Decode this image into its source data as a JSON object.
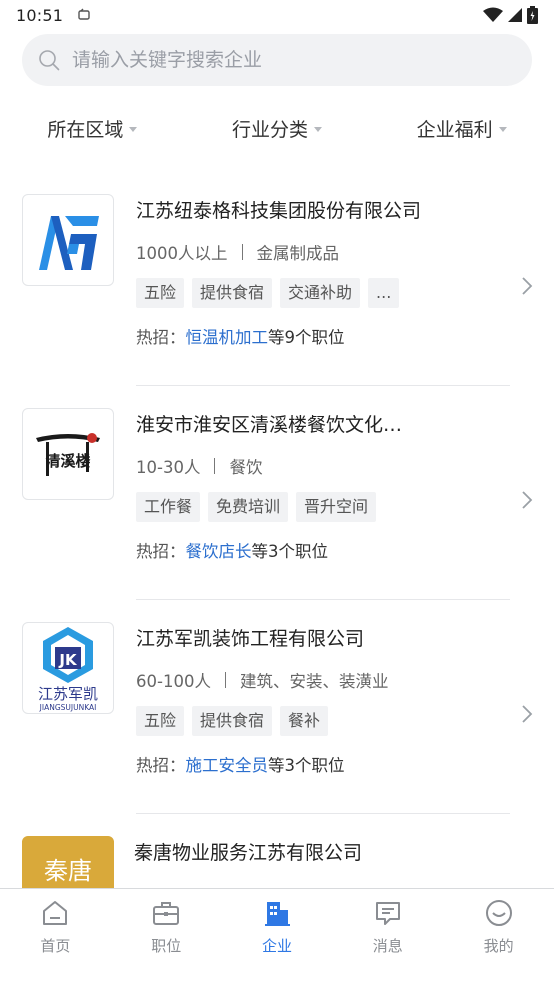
{
  "status_bar": {
    "time": "10:51"
  },
  "search": {
    "placeholder": "请输入关键字搜索企业"
  },
  "filters": [
    {
      "label": "所在区域"
    },
    {
      "label": "行业分类"
    },
    {
      "label": "企业福利"
    }
  ],
  "companies": [
    {
      "name": "江苏纽泰格科技集团股份有限公司",
      "size": "1000人以上",
      "industry": "金属制成品",
      "tags": [
        "五险",
        "提供食宿",
        "交通补助",
        "..."
      ],
      "hot_prefix": "热招：",
      "hot_job": "恒温机加工",
      "hot_suffix": "等9个职位"
    },
    {
      "name": "淮安市淮安区清溪楼餐饮文化…",
      "logo_text": "清溪楼",
      "size": "10-30人",
      "industry": "餐饮",
      "tags": [
        "工作餐",
        "免费培训",
        "晋升空间"
      ],
      "hot_prefix": "热招：",
      "hot_job": "餐饮店长",
      "hot_suffix": "等3个职位"
    },
    {
      "name": "江苏军凯装饰工程有限公司",
      "logo_text_cn": "江苏军凯",
      "logo_text_en": "JIANGSUJUNKAI",
      "size": "60-100人",
      "industry": "建筑、安装、装潢业",
      "tags": [
        "五险",
        "提供食宿",
        "餐补"
      ],
      "hot_prefix": "热招：",
      "hot_job": "施工安全员",
      "hot_suffix": "等3个职位"
    },
    {
      "name": "秦唐物业服务江苏有限公司",
      "logo_text": "秦唐"
    }
  ],
  "tabbar": [
    {
      "label": "首页",
      "icon": "home-icon"
    },
    {
      "label": "职位",
      "icon": "briefcase-icon"
    },
    {
      "label": "企业",
      "icon": "building-icon",
      "active": true
    },
    {
      "label": "消息",
      "icon": "message-icon"
    },
    {
      "label": "我的",
      "icon": "profile-icon"
    }
  ],
  "colors": {
    "accent": "#2f78e4",
    "link": "#2c6fce",
    "tag_bg": "#f1f2f4"
  }
}
